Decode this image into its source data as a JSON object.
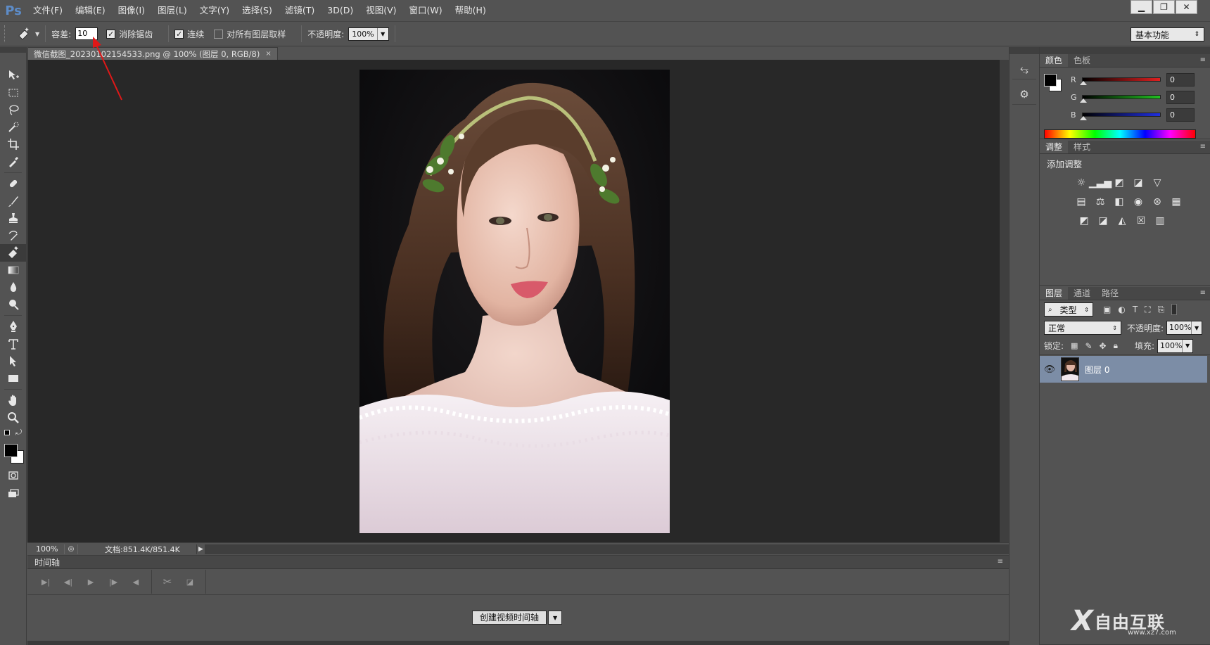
{
  "app": {
    "logo": "Ps"
  },
  "menu": [
    "文件(F)",
    "编辑(E)",
    "图像(I)",
    "图层(L)",
    "文字(Y)",
    "选择(S)",
    "滤镜(T)",
    "3D(D)",
    "视图(V)",
    "窗口(W)",
    "帮助(H)"
  ],
  "window_controls": {
    "minimize": "▁",
    "restore": "❐",
    "close": "✕"
  },
  "options": {
    "tolerance_label": "容差:",
    "tolerance_value": "10",
    "antialias_label": "消除锯齿",
    "antialias_checked": true,
    "contiguous_label": "连续",
    "contiguous_checked": true,
    "all_layers_label": "对所有图层取样",
    "all_layers_checked": false,
    "opacity_label": "不透明度:",
    "opacity_value": "100%",
    "workspace": "基本功能"
  },
  "document": {
    "tab_title": "微信截图_20230102154533.png @ 100% (图层 0, RGB/8)",
    "tab_close": "×",
    "zoom": "100%",
    "doc_size": "文档:851.4K/851.4K"
  },
  "timeline": {
    "title": "时间轴",
    "create_button": "创建视频时间轴"
  },
  "color_panel": {
    "tabs": [
      "颜色",
      "色板"
    ],
    "channels": [
      {
        "label": "R",
        "value": "0",
        "color": "#e02020"
      },
      {
        "label": "G",
        "value": "0",
        "color": "#20c020"
      },
      {
        "label": "B",
        "value": "0",
        "color": "#2030e0"
      }
    ]
  },
  "adjust_panel": {
    "tabs": [
      "调整",
      "样式"
    ],
    "heading": "添加调整"
  },
  "layers_panel": {
    "tabs": [
      "图层",
      "通道",
      "路径"
    ],
    "filter_kind": "类型",
    "blend_mode": "正常",
    "opacity_label": "不透明度:",
    "opacity_value": "100%",
    "lock_label": "锁定:",
    "fill_label": "填充:",
    "fill_value": "100%",
    "layers": [
      {
        "name": "图层 0",
        "visible": true
      }
    ]
  },
  "watermark": {
    "mark": "X",
    "text": "自由互联",
    "url": "www.xz7.com"
  },
  "colors": {
    "accent_layer": "#7c8da6",
    "canvas_bg": "#282828",
    "ui_bg": "#535353"
  }
}
